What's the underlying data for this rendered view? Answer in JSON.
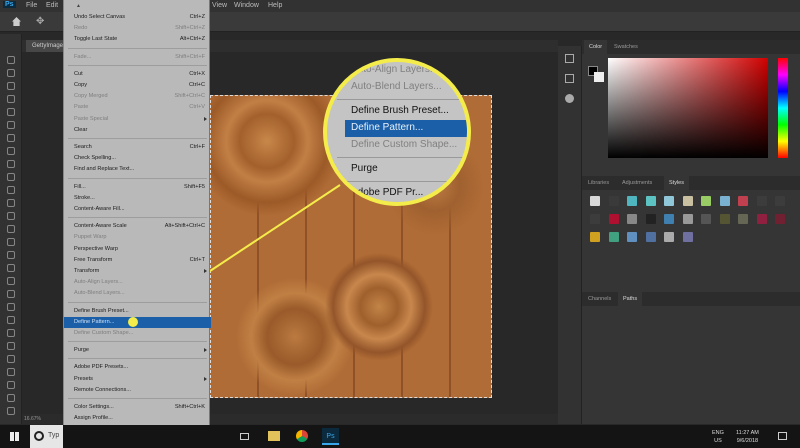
{
  "app": {
    "logo": "Ps",
    "menus": [
      "File",
      "Edit",
      "Image",
      "Layer",
      "Type",
      "Select",
      "Filter",
      "3D",
      "View",
      "Window",
      "Help"
    ]
  },
  "document_tab": {
    "label": "GettyImages..."
  },
  "status_bar": {
    "zoom": "16.67%"
  },
  "edit_menu": {
    "items": [
      {
        "label": "Undo Select Canvas",
        "shortcut": "Ctrl+Z"
      },
      {
        "label": "Redo",
        "shortcut": "Shift+Ctrl+Z",
        "disabled": true
      },
      {
        "label": "Toggle Last State",
        "shortcut": "Alt+Ctrl+Z"
      },
      {
        "label": "Fade...",
        "shortcut": "Shift+Ctrl+F",
        "disabled": true,
        "separator_before": true
      },
      {
        "label": "Cut",
        "shortcut": "Ctrl+X",
        "separator_before": true
      },
      {
        "label": "Copy",
        "shortcut": "Ctrl+C"
      },
      {
        "label": "Copy Merged",
        "shortcut": "Shift+Ctrl+C",
        "disabled": true
      },
      {
        "label": "Paste",
        "shortcut": "Ctrl+V",
        "disabled": true
      },
      {
        "label": "Paste Special",
        "disabled": true,
        "submenu": true
      },
      {
        "label": "Clear"
      },
      {
        "label": "Search",
        "shortcut": "Ctrl+F",
        "separator_before": true
      },
      {
        "label": "Check Spelling..."
      },
      {
        "label": "Find and Replace Text..."
      },
      {
        "label": "Fill...",
        "shortcut": "Shift+F5",
        "separator_before": true
      },
      {
        "label": "Stroke..."
      },
      {
        "label": "Content-Aware Fill..."
      },
      {
        "label": "Content-Aware Scale",
        "shortcut": "Alt+Shift+Ctrl+C",
        "separator_before": true
      },
      {
        "label": "Puppet Warp",
        "disabled": true
      },
      {
        "label": "Perspective Warp"
      },
      {
        "label": "Free Transform",
        "shortcut": "Ctrl+T"
      },
      {
        "label": "Transform",
        "submenu": true
      },
      {
        "label": "Auto-Align Layers...",
        "disabled": true
      },
      {
        "label": "Auto-Blend Layers...",
        "disabled": true
      },
      {
        "label": "Define Brush Preset...",
        "separator_before": true
      },
      {
        "label": "Define Pattern...",
        "highlighted": true
      },
      {
        "label": "Define Custom Shape...",
        "disabled": true
      },
      {
        "label": "Purge",
        "submenu": true,
        "separator_before": true
      },
      {
        "label": "Adobe PDF Presets...",
        "separator_before": true
      },
      {
        "label": "Presets",
        "submenu": true
      },
      {
        "label": "Remote Connections..."
      },
      {
        "label": "Color Settings...",
        "shortcut": "Shift+Ctrl+K",
        "separator_before": true
      },
      {
        "label": "Assign Profile..."
      },
      {
        "label": "Convert to Profile..."
      }
    ],
    "more_icon": "chevron-down-icon"
  },
  "magnifier": {
    "items": [
      {
        "label": "Auto-Align Layers...",
        "disabled": true
      },
      {
        "label": "Auto-Blend Layers...",
        "disabled": true
      },
      {
        "label": "Define Brush Preset...",
        "separator_before": true
      },
      {
        "label": "Define Pattern...",
        "highlighted": true
      },
      {
        "label": "Define Custom Shape...",
        "disabled": true
      },
      {
        "label": "Purge",
        "separator_before": true
      },
      {
        "label": "Adobe PDF Pr...",
        "separator_before": true
      }
    ],
    "callout_color": "#f3ec4a"
  },
  "panels": {
    "color_tabs": [
      "Color",
      "Swatches"
    ],
    "style_tabs": [
      "Libraries",
      "Adjustments",
      "Styles"
    ],
    "bottom_tabs": [
      "Channels",
      "Paths"
    ]
  },
  "taskbar": {
    "search_placeholder": "Typ",
    "language": "ENG",
    "region": "US",
    "time": "11:27 AM",
    "date": "9/6/2018",
    "apps": [
      "task-view",
      "file-explorer",
      "chrome",
      "photoshop"
    ]
  }
}
